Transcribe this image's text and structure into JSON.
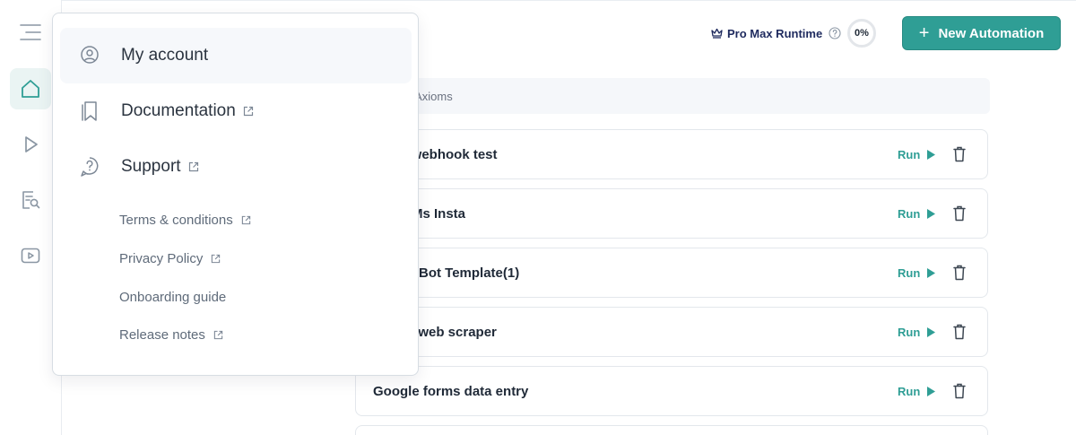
{
  "header": {
    "runtime_label": "Pro Max Runtime",
    "progress_value": "0%",
    "new_automation_label": "New Automation"
  },
  "search": {
    "text": "n Axioms"
  },
  "automations": [
    {
      "name": "an webhook test",
      "run_label": "Run"
    },
    {
      "name": "Ms Insta",
      "run_label": "Run"
    },
    {
      "name": "Bot Template(1)",
      "run_label": "Run"
    },
    {
      "name": "g web scraper",
      "run_label": "Run"
    },
    {
      "name": "Google forms data entry",
      "run_label": "Run"
    }
  ],
  "menu": {
    "items": [
      {
        "label": "My account",
        "icon": "user-circle-icon"
      },
      {
        "label": "Documentation",
        "icon": "bookmark-icon",
        "external": true
      },
      {
        "label": "Support",
        "icon": "help-circle-icon",
        "external": true
      }
    ],
    "links": [
      {
        "label": "Terms & conditions",
        "external": true
      },
      {
        "label": "Privacy Policy",
        "external": true
      },
      {
        "label": "Onboarding guide",
        "external": false
      },
      {
        "label": "Release notes",
        "external": true
      }
    ]
  },
  "sidebar": {
    "items": [
      "menu-icon",
      "home-icon",
      "play-icon",
      "search-document-icon",
      "video-icon"
    ]
  },
  "colors": {
    "accent": "#2f9e95",
    "runtime_text": "#1e2a5e"
  }
}
